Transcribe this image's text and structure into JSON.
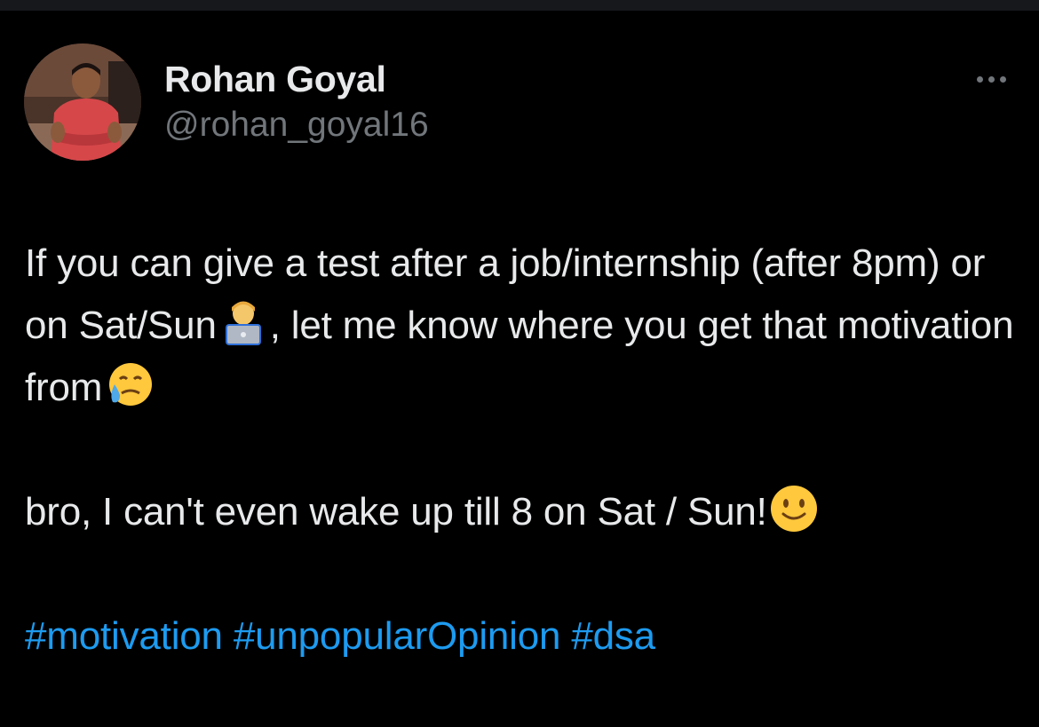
{
  "author": {
    "name": "Rohan Goyal",
    "handle": "@rohan_goyal16",
    "avatar_icon": "profile-photo"
  },
  "menu": {
    "more_icon": "ellipsis-icon"
  },
  "tweet": {
    "line1_text": "If you can give a test after a job/internship (after 8pm) or on Sat/Sun",
    "line1_emoji": "technologist",
    "line1_after": ", let me know where you get that motivation from",
    "line1_end_emoji": "face-holding-back-tears",
    "line2_text": "bro, I can't even wake up till 8 on Sat / Sun!",
    "line2_emoji": "slightly-smiling-face",
    "hashtags": [
      "#motivation",
      "#unpopularOpinion",
      "#dsa"
    ]
  },
  "colors": {
    "background": "#000000",
    "text": "#E7E9EA",
    "secondary": "#71767B",
    "link": "#1D9BF0"
  }
}
